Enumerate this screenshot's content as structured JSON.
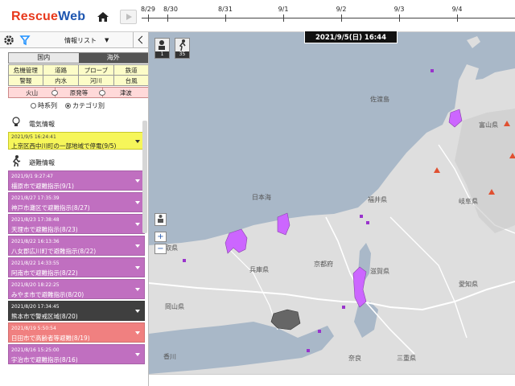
{
  "app": {
    "logo_part1": "Rescue",
    "logo_part2": "Web"
  },
  "timeline": {
    "labels": [
      "8/29",
      "8/30",
      "8/31",
      "9/1",
      "9/2",
      "9/3",
      "9/4"
    ]
  },
  "panel": {
    "list_title": "情報リスト",
    "list_caret": "▼",
    "region_tabs": [
      "国内",
      "海外"
    ],
    "categories": [
      "危機管理",
      "道路",
      "プローブ",
      "鉄道",
      "警報",
      "内水",
      "河川",
      "台風"
    ],
    "hazards": [
      "火山",
      "原発等",
      "津波"
    ],
    "sort_options": [
      "時系列",
      "カテゴリ別"
    ],
    "sections": {
      "power": {
        "label": "電気情報",
        "card": {
          "time": "2021/9/5 16:24:41",
          "text": "上京区西中川町の一部地域で停電(9/5)"
        }
      },
      "evac": {
        "label": "避難情報",
        "cards": [
          {
            "time": "2021/9/1 9:27:47",
            "text": "橿原市で避難指示(9/1)",
            "color": "#c06fc0"
          },
          {
            "time": "2021/8/27 17:35:39",
            "text": "神戸市灘区で避難指示(8/27)",
            "color": "#c06fc0"
          },
          {
            "time": "2021/8/23 17:38:48",
            "text": "天理市で避難指示(8/23)",
            "color": "#c06fc0"
          },
          {
            "time": "2021/8/22 16:13:36",
            "text": "八女郡広川町で避難指示(8/22)",
            "color": "#c06fc0"
          },
          {
            "time": "2021/8/22 14:33:55",
            "text": "阿南市で避難指示(8/22)",
            "color": "#c06fc0"
          },
          {
            "time": "2021/8/20 18:22:25",
            "text": "みやま市で避難指示(8/20)",
            "color": "#c06fc0"
          },
          {
            "time": "2021/8/20 17:34:45",
            "text": "熊本市で警戒区域(8/20)",
            "color": "#3f3f3f"
          },
          {
            "time": "2021/8/19 5:50:54",
            "text": "日田市で高齢者等避難(8/19)",
            "color": "#f08080"
          },
          {
            "time": "2021/8/16 15:25:00",
            "text": "宇治市で避難指示(8/16)",
            "color": "#c06fc0"
          }
        ]
      }
    }
  },
  "map": {
    "datetime": "2021/9/5(日) 16:44",
    "badges": [
      "1",
      "35"
    ],
    "zoom_in": "+",
    "zoom_out": "−",
    "labels": {
      "sado": "佐渡島",
      "toyama": "富山県",
      "nihonkai": "日本海",
      "fukui": "福井県",
      "gifu": "岐阜県",
      "hyogo": "兵庫県",
      "kyoto": "京都府",
      "shiga": "滋賀県",
      "aichi": "愛知県",
      "okayama": "岡山県",
      "mie": "三重県",
      "nara": "奈良",
      "kagawa": "香川",
      "tottori": "取県"
    }
  }
}
